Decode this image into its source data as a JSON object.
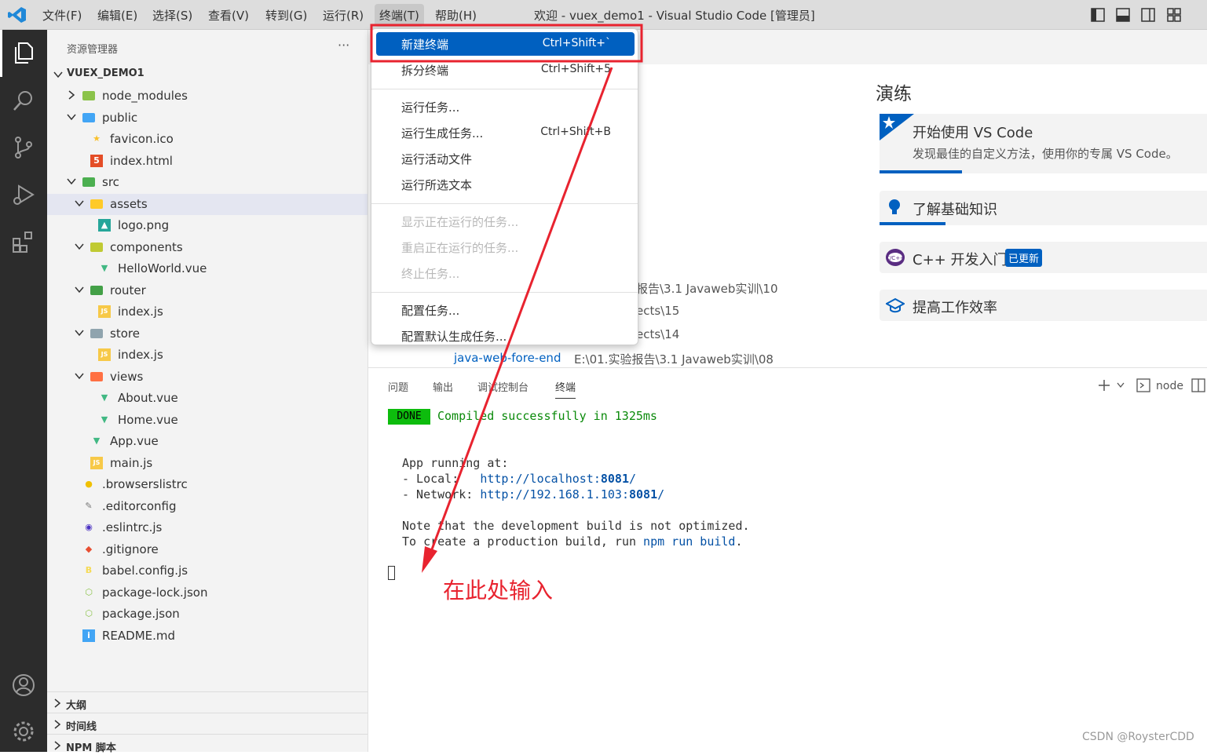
{
  "menubar": {
    "items": [
      "文件(F)",
      "编辑(E)",
      "选择(S)",
      "查看(V)",
      "转到(G)",
      "运行(R)",
      "终端(T)",
      "帮助(H)"
    ],
    "window_title": "欢迎 - vuex_demo1 - Visual Studio Code [管理员]"
  },
  "sidebar": {
    "title": "资源管理器",
    "more": "···",
    "root": "VUEX_DEMO1",
    "tree": [
      {
        "label": "node_modules",
        "depth": 1,
        "chevron": "right",
        "icon": "folder-node"
      },
      {
        "label": "public",
        "depth": 1,
        "chevron": "down",
        "icon": "folder-public"
      },
      {
        "label": "favicon.ico",
        "depth": 2,
        "chevron": "",
        "icon": "star"
      },
      {
        "label": "index.html",
        "depth": 2,
        "chevron": "",
        "icon": "html"
      },
      {
        "label": "src",
        "depth": 1,
        "chevron": "down",
        "icon": "folder-src"
      },
      {
        "label": "assets",
        "depth": 2,
        "chevron": "down",
        "icon": "folder-assets",
        "selected": true
      },
      {
        "label": "logo.png",
        "depth": 3,
        "chevron": "",
        "icon": "image"
      },
      {
        "label": "components",
        "depth": 2,
        "chevron": "down",
        "icon": "folder-components"
      },
      {
        "label": "HelloWorld.vue",
        "depth": 3,
        "chevron": "",
        "icon": "vue"
      },
      {
        "label": "router",
        "depth": 2,
        "chevron": "down",
        "icon": "folder-router"
      },
      {
        "label": "index.js",
        "depth": 3,
        "chevron": "",
        "icon": "js"
      },
      {
        "label": "store",
        "depth": 2,
        "chevron": "down",
        "icon": "folder-store"
      },
      {
        "label": "index.js",
        "depth": 3,
        "chevron": "",
        "icon": "js"
      },
      {
        "label": "views",
        "depth": 2,
        "chevron": "down",
        "icon": "folder-views"
      },
      {
        "label": "About.vue",
        "depth": 3,
        "chevron": "",
        "icon": "vue"
      },
      {
        "label": "Home.vue",
        "depth": 3,
        "chevron": "",
        "icon": "vue"
      },
      {
        "label": "App.vue",
        "depth": 2,
        "chevron": "",
        "icon": "vue"
      },
      {
        "label": "main.js",
        "depth": 2,
        "chevron": "",
        "icon": "js"
      },
      {
        "label": ".browserslistrc",
        "depth": 1,
        "chevron": "",
        "icon": "browserslist"
      },
      {
        "label": ".editorconfig",
        "depth": 1,
        "chevron": "",
        "icon": "editorconfig"
      },
      {
        "label": ".eslintrc.js",
        "depth": 1,
        "chevron": "",
        "icon": "eslint"
      },
      {
        "label": ".gitignore",
        "depth": 1,
        "chevron": "",
        "icon": "git"
      },
      {
        "label": "babel.config.js",
        "depth": 1,
        "chevron": "",
        "icon": "babel"
      },
      {
        "label": "package-lock.json",
        "depth": 1,
        "chevron": "",
        "icon": "npm"
      },
      {
        "label": "package.json",
        "depth": 1,
        "chevron": "",
        "icon": "npm"
      },
      {
        "label": "README.md",
        "depth": 1,
        "chevron": "",
        "icon": "info"
      }
    ],
    "sections": [
      "大纲",
      "时间线",
      "NPM 脚本"
    ]
  },
  "terminal_menu": {
    "groups": [
      [
        {
          "label": "新建终端",
          "shortcut": "Ctrl+Shift+`",
          "active": true
        },
        {
          "label": "拆分终端",
          "shortcut": "Ctrl+Shift+5"
        }
      ],
      [
        {
          "label": "运行任务...",
          "shortcut": ""
        },
        {
          "label": "运行生成任务...",
          "shortcut": "Ctrl+Shift+B"
        },
        {
          "label": "运行活动文件",
          "shortcut": ""
        },
        {
          "label": "运行所选文本",
          "shortcut": ""
        }
      ],
      [
        {
          "label": "显示正在运行的任务...",
          "shortcut": "",
          "disabled": true
        },
        {
          "label": "重启正在运行的任务...",
          "shortcut": "",
          "disabled": true
        },
        {
          "label": "终止任务...",
          "shortcut": "",
          "disabled": true
        }
      ],
      [
        {
          "label": "配置任务...",
          "shortcut": ""
        },
        {
          "label": "配置默认生成任务...",
          "shortcut": ""
        }
      ]
    ]
  },
  "welcome": {
    "walkthroughs_title": "演练",
    "cards": [
      {
        "title": "开始使用 VS Code",
        "desc": "发现最佳的自定义方法，使用你的专属 VS Code。",
        "icon": "star-icon",
        "progress": 0.25
      },
      {
        "title": "了解基础知识",
        "icon": "lightbulb-icon",
        "progress": 0.2
      },
      {
        "title": "C++ 开发入门",
        "badge": "已更新",
        "icon": "cpp-icon"
      },
      {
        "title": "提高工作效率",
        "icon": "mortarboard-icon"
      }
    ],
    "recent": [
      {
        "name": "",
        "path": "报告\\3.1 Javaweb实训\\10"
      },
      {
        "name": "",
        "path": "ects\\15"
      },
      {
        "name": "",
        "path": "ects\\14"
      },
      {
        "name": "java-web-fore-end",
        "path": "E:\\01.实验报告\\3.1 Javaweb实训\\08"
      }
    ]
  },
  "panel": {
    "tabs": [
      "问题",
      "输出",
      "调试控制台",
      "终端"
    ],
    "active_tab": "终端",
    "terminal_name": "node",
    "terminal": {
      "done_badge": "DONE",
      "compiled": "Compiled successfully in 1325ms",
      "running": "App running at:",
      "local_label": "- Local:   ",
      "local_url_pre": "http://localhost:",
      "local_port": "8081",
      "network_label": "- Network: ",
      "network_url_pre": "http://192.168.1.103:",
      "network_port": "8081",
      "note1": "Note that the development build is not optimized.",
      "note2_pre": "To create a production build, run ",
      "note2_cmd": "npm run build",
      "note2_post": "."
    }
  },
  "annotation": {
    "text": "在此处输入",
    "color": "#e8232f"
  },
  "watermark": "CSDN @RoysterCDD"
}
